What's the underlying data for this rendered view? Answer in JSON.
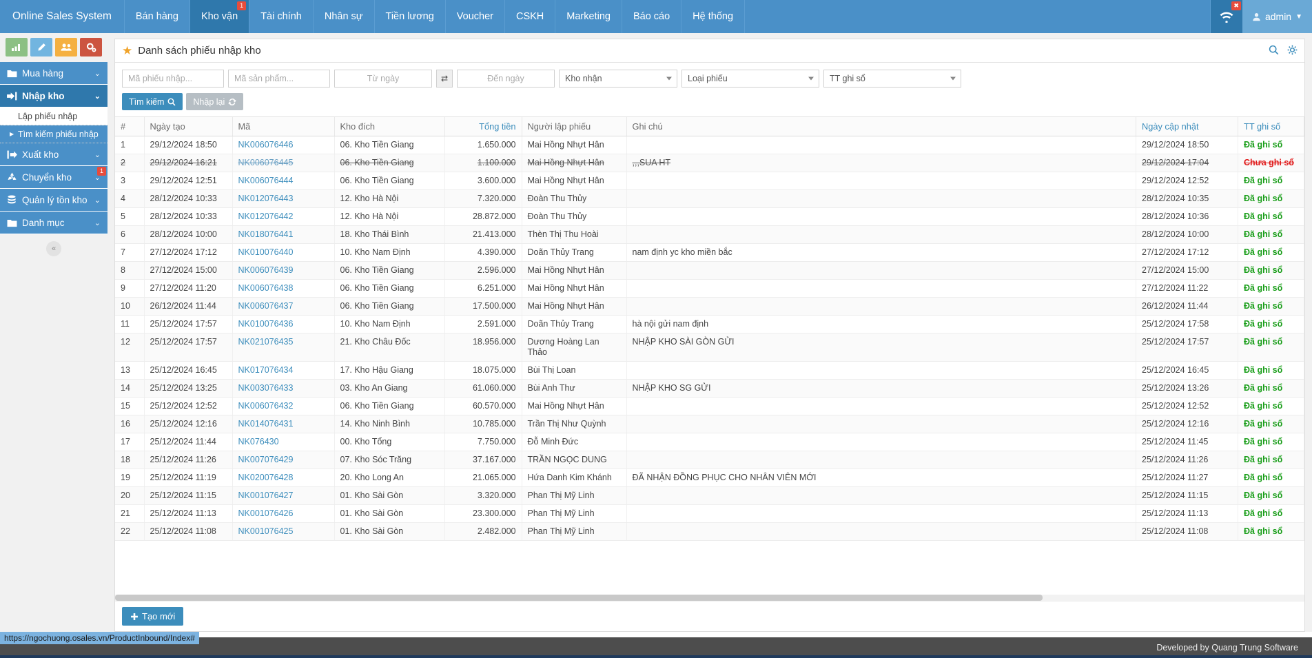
{
  "topnav": {
    "brand": "Online Sales System",
    "items": [
      {
        "label": "Bán hàng",
        "active": false,
        "badge": ""
      },
      {
        "label": "Kho vận",
        "active": true,
        "badge": "1"
      },
      {
        "label": "Tài chính",
        "active": false,
        "badge": ""
      },
      {
        "label": "Nhân sự",
        "active": false,
        "badge": ""
      },
      {
        "label": "Tiền lương",
        "active": false,
        "badge": ""
      },
      {
        "label": "Voucher",
        "active": false,
        "badge": ""
      },
      {
        "label": "CSKH",
        "active": false,
        "badge": ""
      },
      {
        "label": "Marketing",
        "active": false,
        "badge": ""
      },
      {
        "label": "Báo cáo",
        "active": false,
        "badge": ""
      },
      {
        "label": "Hệ thống",
        "active": false,
        "badge": ""
      }
    ],
    "wifi_icon": "wifi-icon",
    "wifi_badge": "✖",
    "user_icon": "user-icon",
    "user_label": "admin",
    "user_caret": "▼"
  },
  "sidebar": {
    "quick_icons": [
      {
        "name": "chart-icon",
        "glyph": "▁▃▅",
        "color": "#8cc084"
      },
      {
        "name": "pencil-icon",
        "glyph": "✎",
        "color": "#72b5e0"
      },
      {
        "name": "users-icon",
        "glyph": "👥",
        "color": "#f5b041"
      },
      {
        "name": "settings-icon",
        "glyph": "⚙",
        "color": "#cc5440"
      }
    ],
    "items": [
      {
        "label": "Mua hàng",
        "icon": "folder-icon",
        "glyph": "📁",
        "active": false,
        "badge": "",
        "caret": "⌄"
      },
      {
        "label": "Nhập kho",
        "icon": "inbound-arrow-icon",
        "glyph": "➜",
        "active": true,
        "badge": "",
        "caret": "⌄"
      },
      {
        "label": "Xuất kho",
        "icon": "outbound-arrow-icon",
        "glyph": "➜",
        "active": false,
        "badge": "",
        "caret": "⌄"
      },
      {
        "label": "Chuyển kho",
        "icon": "recycle-icon",
        "glyph": "♻",
        "active": false,
        "badge": "1",
        "caret": "⌄"
      },
      {
        "label": "Quản lý tồn kho",
        "icon": "database-icon",
        "glyph": "▤",
        "active": false,
        "badge": "",
        "caret": "⌄"
      },
      {
        "label": "Danh mục",
        "icon": "folder-icon",
        "glyph": "📁",
        "active": false,
        "badge": "",
        "caret": "⌄"
      }
    ],
    "sub_items": [
      {
        "label": "Lập phiếu nhập",
        "active": false
      },
      {
        "label": "Tìm kiếm phiếu nhập",
        "active": true
      }
    ],
    "collapse_glyph": "«"
  },
  "panel": {
    "title": "Danh sách phiếu nhập kho",
    "star_icon": "star-icon",
    "search_icon": "search-icon",
    "gear_icon": "gear-icon"
  },
  "filters": {
    "code_placeholder": "Mã phiếu nhập...",
    "code_value": "",
    "product_placeholder": "Mã sản phẩm...",
    "product_value": "",
    "from_placeholder": "Từ ngày",
    "from_value": "",
    "to_placeholder": "Đến ngày",
    "to_value": "",
    "swap_icon": "swap-icon",
    "warehouse_label": "Kho nhận",
    "voucher_type_label": "Loại phiếu",
    "status_label": "TT ghi sổ",
    "search_button": "Tìm kiếm",
    "search_button_icon": "search-icon",
    "reset_button": "Nhập lại",
    "reset_button_icon": "refresh-icon"
  },
  "table": {
    "headers": [
      {
        "label": "#",
        "sortable": false,
        "align": "left"
      },
      {
        "label": "Ngày tạo",
        "sortable": false,
        "align": "left"
      },
      {
        "label": "Mã",
        "sortable": false,
        "align": "left"
      },
      {
        "label": "Kho đích",
        "sortable": false,
        "align": "left"
      },
      {
        "label": "Tổng tiền",
        "sortable": true,
        "align": "right"
      },
      {
        "label": "Người lập phiếu",
        "sortable": false,
        "align": "left"
      },
      {
        "label": "Ghi chú",
        "sortable": false,
        "align": "left"
      },
      {
        "label": "Ngày cập nhật",
        "sortable": true,
        "align": "left"
      },
      {
        "label": "TT ghi số",
        "sortable": true,
        "align": "left"
      }
    ],
    "rows": [
      {
        "idx": "1",
        "created": "29/12/2024 18:50",
        "code": "NK006076446",
        "warehouse": "06. Kho Tiền Giang",
        "amount": "1.650.000",
        "user": "Mai Hồng Nhựt Hân",
        "note": "",
        "updated": "29/12/2024 18:50",
        "status": "Đã ghi sổ",
        "voided": false
      },
      {
        "idx": "2",
        "created": "29/12/2024 16:21",
        "code": "NK006076445",
        "warehouse": "06. Kho Tiền Giang",
        "amount": "1.100.000",
        "user": "Mai Hồng Nhựt Hân",
        "note": ",,,SUA HT",
        "updated": "29/12/2024 17:04",
        "status": "Chưa ghi sổ",
        "voided": true
      },
      {
        "idx": "3",
        "created": "29/12/2024 12:51",
        "code": "NK006076444",
        "warehouse": "06. Kho Tiền Giang",
        "amount": "3.600.000",
        "user": "Mai Hồng Nhựt Hân",
        "note": "",
        "updated": "29/12/2024 12:52",
        "status": "Đã ghi sổ",
        "voided": false
      },
      {
        "idx": "4",
        "created": "28/12/2024 10:33",
        "code": "NK012076443",
        "warehouse": "12. Kho Hà Nội",
        "amount": "7.320.000",
        "user": "Đoàn Thu Thủy",
        "note": "",
        "updated": "28/12/2024 10:35",
        "status": "Đã ghi sổ",
        "voided": false
      },
      {
        "idx": "5",
        "created": "28/12/2024 10:33",
        "code": "NK012076442",
        "warehouse": "12. Kho Hà Nội",
        "amount": "28.872.000",
        "user": "Đoàn Thu Thủy",
        "note": "",
        "updated": "28/12/2024 10:36",
        "status": "Đã ghi sổ",
        "voided": false
      },
      {
        "idx": "6",
        "created": "28/12/2024 10:00",
        "code": "NK018076441",
        "warehouse": "18. Kho Thái Bình",
        "amount": "21.413.000",
        "user": "Thèn Thị Thu Hoài",
        "note": "",
        "updated": "28/12/2024 10:00",
        "status": "Đã ghi sổ",
        "voided": false
      },
      {
        "idx": "7",
        "created": "27/12/2024 17:12",
        "code": "NK010076440",
        "warehouse": "10. Kho Nam Định",
        "amount": "4.390.000",
        "user": "Doãn Thủy Trang",
        "note": "nam định yc kho miền bắc",
        "updated": "27/12/2024 17:12",
        "status": "Đã ghi sổ",
        "voided": false
      },
      {
        "idx": "8",
        "created": "27/12/2024 15:00",
        "code": "NK006076439",
        "warehouse": "06. Kho Tiền Giang",
        "amount": "2.596.000",
        "user": "Mai Hồng Nhựt Hân",
        "note": "",
        "updated": "27/12/2024 15:00",
        "status": "Đã ghi sổ",
        "voided": false
      },
      {
        "idx": "9",
        "created": "27/12/2024 11:20",
        "code": "NK006076438",
        "warehouse": "06. Kho Tiền Giang",
        "amount": "6.251.000",
        "user": "Mai Hồng Nhựt Hân",
        "note": "",
        "updated": "27/12/2024 11:22",
        "status": "Đã ghi sổ",
        "voided": false
      },
      {
        "idx": "10",
        "created": "26/12/2024 11:44",
        "code": "NK006076437",
        "warehouse": "06. Kho Tiền Giang",
        "amount": "17.500.000",
        "user": "Mai Hồng Nhựt Hân",
        "note": "",
        "updated": "26/12/2024 11:44",
        "status": "Đã ghi sổ",
        "voided": false
      },
      {
        "idx": "11",
        "created": "25/12/2024 17:57",
        "code": "NK010076436",
        "warehouse": "10. Kho Nam Định",
        "amount": "2.591.000",
        "user": "Doãn Thủy Trang",
        "note": "hà nội gửi nam định",
        "updated": "25/12/2024 17:58",
        "status": "Đã ghi sổ",
        "voided": false
      },
      {
        "idx": "12",
        "created": "25/12/2024 17:57",
        "code": "NK021076435",
        "warehouse": "21. Kho Châu Đốc",
        "amount": "18.956.000",
        "user": "Dương Hoàng Lan Thảo",
        "note": "NHẬP KHO SÀI GÒN GỬI",
        "updated": "25/12/2024 17:57",
        "status": "Đã ghi sổ",
        "voided": false
      },
      {
        "idx": "13",
        "created": "25/12/2024 16:45",
        "code": "NK017076434",
        "warehouse": "17. Kho Hậu Giang",
        "amount": "18.075.000",
        "user": "Bùi Thị Loan",
        "note": "",
        "updated": "25/12/2024 16:45",
        "status": "Đã ghi sổ",
        "voided": false
      },
      {
        "idx": "14",
        "created": "25/12/2024 13:25",
        "code": "NK003076433",
        "warehouse": "03. Kho An Giang",
        "amount": "61.060.000",
        "user": "Bùi Anh Thư",
        "note": "NHẬP KHO SG GỬI",
        "updated": "25/12/2024 13:26",
        "status": "Đã ghi sổ",
        "voided": false
      },
      {
        "idx": "15",
        "created": "25/12/2024 12:52",
        "code": "NK006076432",
        "warehouse": "06. Kho Tiền Giang",
        "amount": "60.570.000",
        "user": "Mai Hồng Nhựt Hân",
        "note": "",
        "updated": "25/12/2024 12:52",
        "status": "Đã ghi sổ",
        "voided": false
      },
      {
        "idx": "16",
        "created": "25/12/2024 12:16",
        "code": "NK014076431",
        "warehouse": "14. Kho Ninh Bình",
        "amount": "10.785.000",
        "user": "Trần Thị Như Quỳnh",
        "note": "",
        "updated": "25/12/2024 12:16",
        "status": "Đã ghi sổ",
        "voided": false
      },
      {
        "idx": "17",
        "created": "25/12/2024 11:44",
        "code": "NK076430",
        "warehouse": "00. Kho Tổng",
        "amount": "7.750.000",
        "user": "Đỗ Minh Đức",
        "note": "",
        "updated": "25/12/2024 11:45",
        "status": "Đã ghi sổ",
        "voided": false
      },
      {
        "idx": "18",
        "created": "25/12/2024 11:26",
        "code": "NK007076429",
        "warehouse": "07. Kho Sóc Trăng",
        "amount": "37.167.000",
        "user": "TRẦN NGỌC DUNG",
        "note": "",
        "updated": "25/12/2024 11:26",
        "status": "Đã ghi sổ",
        "voided": false
      },
      {
        "idx": "19",
        "created": "25/12/2024 11:19",
        "code": "NK020076428",
        "warehouse": "20. Kho Long An",
        "amount": "21.065.000",
        "user": "Hứa Danh Kim Khánh",
        "note": "ĐÃ NHẬN ĐỒNG PHỤC CHO NHÂN VIÊN MỚI",
        "updated": "25/12/2024 11:27",
        "status": "Đã ghi sổ",
        "voided": false
      },
      {
        "idx": "20",
        "created": "25/12/2024 11:15",
        "code": "NK001076427",
        "warehouse": "01. Kho Sài Gòn",
        "amount": "3.320.000",
        "user": "Phan Thị Mỹ Linh",
        "note": "",
        "updated": "25/12/2024 11:15",
        "status": "Đã ghi sổ",
        "voided": false
      },
      {
        "idx": "21",
        "created": "25/12/2024 11:13",
        "code": "NK001076426",
        "warehouse": "01. Kho Sài Gòn",
        "amount": "23.300.000",
        "user": "Phan Thị Mỹ Linh",
        "note": "",
        "updated": "25/12/2024 11:13",
        "status": "Đã ghi sổ",
        "voided": false
      },
      {
        "idx": "22",
        "created": "25/12/2024 11:08",
        "code": "NK001076425",
        "warehouse": "01. Kho Sài Gòn",
        "amount": "2.482.000",
        "user": "Phan Thị Mỹ Linh",
        "note": "",
        "updated": "25/12/2024 11:08",
        "status": "Đã ghi sổ",
        "voided": false
      }
    ]
  },
  "footer_actions": {
    "create_button": "Tạo mới",
    "create_icon": "plus-icon"
  },
  "statusbar": {
    "url": "https://ngochuong.osales.vn/ProductInbound/Index#",
    "credit": "Developed by Quang Trung Software"
  },
  "colors": {
    "brand_blue": "#4a90c8",
    "active_blue": "#2f78ac",
    "link_blue": "#3c8dbc",
    "status_ok": "#1a9e1a",
    "status_pending": "#e01b1b",
    "badge_red": "#e74c3c"
  }
}
